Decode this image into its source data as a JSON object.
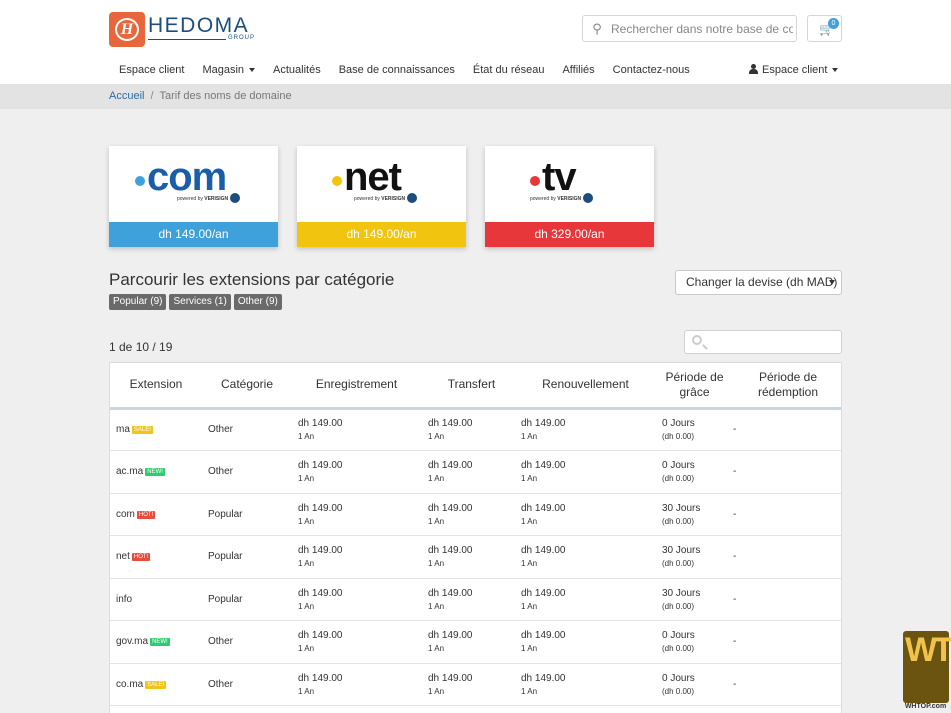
{
  "brand": {
    "name": "HEDOMA",
    "group": "GROUP",
    "mark": "H"
  },
  "search": {
    "placeholder": "Rechercher dans notre base de connaissances"
  },
  "cart": {
    "count": "0"
  },
  "nav": {
    "items": [
      {
        "label": "Espace client",
        "dropdown": false
      },
      {
        "label": "Magasin",
        "dropdown": true
      },
      {
        "label": "Actualités",
        "dropdown": false
      },
      {
        "label": "Base de connaissances",
        "dropdown": false
      },
      {
        "label": "État du réseau",
        "dropdown": false
      },
      {
        "label": "Affiliés",
        "dropdown": false
      },
      {
        "label": "Contactez-nous",
        "dropdown": false
      }
    ],
    "account_label": "Espace client"
  },
  "breadcrumb": {
    "home": "Accueil",
    "current": "Tarif des noms de domaine"
  },
  "featured": [
    {
      "tld": "com",
      "price": "dh 149.00/an",
      "color": "#3fa1da",
      "dot": "#3fa1da",
      "text_color": "#1b5ea8"
    },
    {
      "tld": "net",
      "price": "dh 149.00/an",
      "color": "#f1c40f",
      "dot": "#f1c40f",
      "text_color": "#111111"
    },
    {
      "tld": "tv",
      "price": "dh 329.00/an",
      "color": "#e8373a",
      "dot": "#e8373a",
      "text_color": "#111111"
    }
  ],
  "powered_by": {
    "prefix": "powered by",
    "brand": "VERISIGN"
  },
  "section": {
    "title": "Parcourir les extensions par catégorie",
    "categories": [
      "Popular (9)",
      "Services (1)",
      "Other (9)"
    ],
    "currency": "Changer la devise (dh MAD)"
  },
  "pager": "1 de 10 / 19",
  "table": {
    "headers": [
      "Extension",
      "Catégorie",
      "Enregistrement",
      "Transfert",
      "Renouvellement",
      "Période de grâce",
      "Période de rédemption"
    ],
    "rows": [
      {
        "ext": "ma",
        "tag": "SALE!",
        "tag_type": "sale",
        "cat": "Other",
        "reg": "dh 149.00",
        "reg_sub": "1 An",
        "tr": "dh 149.00",
        "tr_sub": "1 An",
        "ren": "dh 149.00",
        "ren_sub": "1 An",
        "grace": "0 Jours",
        "grace_sub": "(dh 0.00)",
        "red": "-"
      },
      {
        "ext": "ac.ma",
        "tag": "NEW!",
        "tag_type": "new",
        "cat": "Other",
        "reg": "dh 149.00",
        "reg_sub": "1 An",
        "tr": "dh 149.00",
        "tr_sub": "1 An",
        "ren": "dh 149.00",
        "ren_sub": "1 An",
        "grace": "0 Jours",
        "grace_sub": "(dh 0.00)",
        "red": "-"
      },
      {
        "ext": "com",
        "tag": "HOT!",
        "tag_type": "hot",
        "cat": "Popular",
        "reg": "dh 149.00",
        "reg_sub": "1 An",
        "tr": "dh 149.00",
        "tr_sub": "1 An",
        "ren": "dh 149.00",
        "ren_sub": "1 An",
        "grace": "30 Jours",
        "grace_sub": "(dh 0.00)",
        "red": "-"
      },
      {
        "ext": "net",
        "tag": "HOT!",
        "tag_type": "hot",
        "cat": "Popular",
        "reg": "dh 149.00",
        "reg_sub": "1 An",
        "tr": "dh 149.00",
        "tr_sub": "1 An",
        "ren": "dh 149.00",
        "ren_sub": "1 An",
        "grace": "30 Jours",
        "grace_sub": "(dh 0.00)",
        "red": "-"
      },
      {
        "ext": "info",
        "tag": "",
        "tag_type": "",
        "cat": "Popular",
        "reg": "dh 149.00",
        "reg_sub": "1 An",
        "tr": "dh 149.00",
        "tr_sub": "1 An",
        "ren": "dh 149.00",
        "ren_sub": "1 An",
        "grace": "30 Jours",
        "grace_sub": "(dh 0.00)",
        "red": "-"
      },
      {
        "ext": "gov.ma",
        "tag": "NEW!",
        "tag_type": "new",
        "cat": "Other",
        "reg": "dh 149.00",
        "reg_sub": "1 An",
        "tr": "dh 149.00",
        "tr_sub": "1 An",
        "ren": "dh 149.00",
        "ren_sub": "1 An",
        "grace": "0 Jours",
        "grace_sub": "(dh 0.00)",
        "red": "-"
      },
      {
        "ext": "co.ma",
        "tag": "SALE!",
        "tag_type": "sale",
        "cat": "Other",
        "reg": "dh 149.00",
        "reg_sub": "1 An",
        "tr": "dh 149.00",
        "tr_sub": "1 An",
        "ren": "dh 149.00",
        "ren_sub": "1 An",
        "grace": "0 Jours",
        "grace_sub": "(dh 0.00)",
        "red": "-"
      }
    ]
  },
  "watermark": {
    "letters": "WT",
    "site": "WHTOP.com"
  }
}
